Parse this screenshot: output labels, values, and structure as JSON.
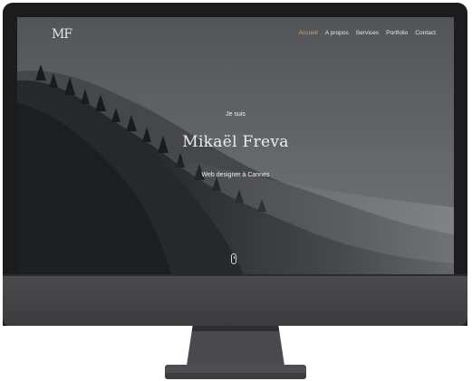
{
  "site": {
    "logo": "MF",
    "nav": [
      "Accueil",
      "A propos",
      "Services",
      "Portfolio",
      "Contact"
    ],
    "active_nav": "Accueil",
    "hero": {
      "pre": "Je suis",
      "name": "Mikaël Freva",
      "sub": "Web designer à Cannes"
    },
    "scroll_icon": "mouse-scroll-icon"
  },
  "colors": {
    "accent": "#d4a56a",
    "monitor_bezel": "#1c1c1e",
    "monitor_chin": "#45454a",
    "stand": "#4a4a4e"
  }
}
